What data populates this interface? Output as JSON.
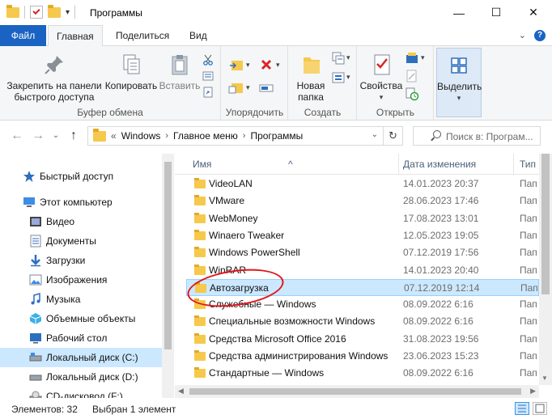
{
  "window": {
    "title": "Программы",
    "minimize": "—",
    "maximize": "☐",
    "close": "✕"
  },
  "tabs": {
    "file": "Файл",
    "home": "Главная",
    "share": "Поделиться",
    "view": "Вид"
  },
  "ribbon": {
    "pin_label": "Закрепить на панели быстрого доступа",
    "copy_label": "Копировать",
    "paste_label": "Вставить",
    "clipboard_group": "Буфер обмена",
    "organize_group": "Упорядочить",
    "new_folder_label": "Новая папка",
    "create_group": "Создать",
    "properties_label": "Свойства",
    "open_group": "Открыть",
    "select_label": "Выделить"
  },
  "address": {
    "prefix": "«",
    "crumbs": [
      "Windows",
      "Главное меню",
      "Программы"
    ],
    "search_placeholder": "Поиск в: Програм..."
  },
  "nav": {
    "items": [
      {
        "label": "Быстрый доступ",
        "icon": "star-icon"
      },
      {
        "label": "Этот компьютер",
        "icon": "computer-icon"
      },
      {
        "label": "Видео",
        "icon": "video-icon"
      },
      {
        "label": "Документы",
        "icon": "documents-icon"
      },
      {
        "label": "Загрузки",
        "icon": "download-icon"
      },
      {
        "label": "Изображения",
        "icon": "pictures-icon"
      },
      {
        "label": "Музыка",
        "icon": "music-icon"
      },
      {
        "label": "Объемные объекты",
        "icon": "3d-objects-icon"
      },
      {
        "label": "Рабочий стол",
        "icon": "desktop-icon"
      },
      {
        "label": "Локальный диск (C:)",
        "icon": "drive-icon"
      },
      {
        "label": "Локальный диск (D:)",
        "icon": "drive-icon"
      },
      {
        "label": "CD-дисковод (F:)",
        "icon": "cd-icon"
      }
    ]
  },
  "files": {
    "columns": {
      "name": "Имя",
      "date": "Дата изменения",
      "type": "Тип"
    },
    "rows": [
      {
        "name": "VideoLAN",
        "date": "14.01.2023 20:37",
        "type": "Пап"
      },
      {
        "name": "VMware",
        "date": "28.06.2023 17:46",
        "type": "Пап"
      },
      {
        "name": "WebMoney",
        "date": "17.08.2023 13:01",
        "type": "Пап"
      },
      {
        "name": "Winaero Tweaker",
        "date": "12.05.2023 19:05",
        "type": "Пап"
      },
      {
        "name": "Windows PowerShell",
        "date": "07.12.2019 17:56",
        "type": "Пап"
      },
      {
        "name": "WinRAR",
        "date": "14.01.2023 20:40",
        "type": "Пап"
      },
      {
        "name": "Автозагрузка",
        "date": "07.12.2019 12:14",
        "type": "Пап"
      },
      {
        "name": "Служебные — Windows",
        "date": "08.09.2022 6:16",
        "type": "Пап"
      },
      {
        "name": "Специальные возможности Windows",
        "date": "08.09.2022 6:16",
        "type": "Пап"
      },
      {
        "name": "Средства Microsoft Office 2016",
        "date": "31.08.2023 19:56",
        "type": "Пап"
      },
      {
        "name": "Средства администрирования Windows",
        "date": "23.06.2023 15:23",
        "type": "Пап"
      },
      {
        "name": "Стандартные — Windows",
        "date": "08.09.2022 6:16",
        "type": "Пап"
      },
      {
        "name": "",
        "date": "14.01.2023 20:37",
        "type": "Пап"
      }
    ],
    "selected_index": 6
  },
  "status": {
    "count": "Элементов: 32",
    "selected": "Выбран 1 элемент"
  },
  "colors": {
    "accent": "#1a63c2",
    "selection": "#cce8ff",
    "annotation": "#e0151a"
  }
}
